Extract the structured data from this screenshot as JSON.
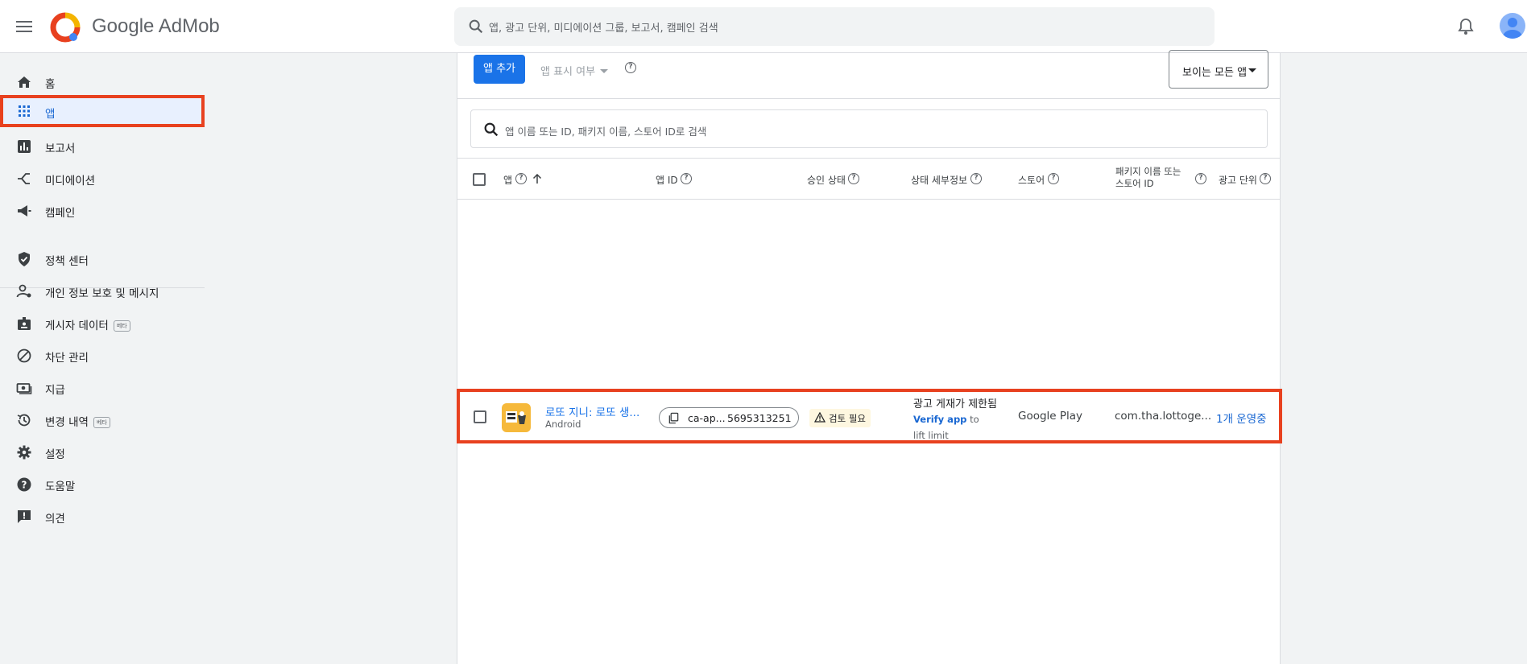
{
  "header": {
    "brand": "Google AdMob",
    "search_placeholder": "앱, 광고 단위, 미디에이션 그룹, 보고서, 캠페인 검색"
  },
  "sidebar": {
    "items": [
      {
        "label": "홈",
        "icon": "home-icon"
      },
      {
        "label": "앱",
        "icon": "apps-grid-icon",
        "active": true
      },
      {
        "label": "보고서",
        "icon": "bar-chart-icon"
      },
      {
        "label": "미디에이션",
        "icon": "mediation-icon"
      },
      {
        "label": "캠페인",
        "icon": "megaphone-icon"
      },
      {
        "label": "정책 센터",
        "icon": "shield-check-icon"
      },
      {
        "label": "개인 정보 보호 및 메시지",
        "icon": "person-settings-icon"
      },
      {
        "label": "게시자 데이터",
        "icon": "badge-icon",
        "badge": "베타"
      },
      {
        "label": "차단 관리",
        "icon": "block-icon"
      },
      {
        "label": "지급",
        "icon": "payments-icon"
      },
      {
        "label": "변경 내역",
        "icon": "history-icon",
        "badge": "베타"
      },
      {
        "label": "설정",
        "icon": "gear-icon"
      },
      {
        "label": "도움말",
        "icon": "help-icon"
      },
      {
        "label": "의견",
        "icon": "feedback-icon"
      }
    ]
  },
  "toolbar": {
    "add_app": "앱 추가",
    "show_toggle": "앱 표시 여부",
    "visible_select": "보이는 모든 앱"
  },
  "app_search_placeholder": "앱 이름 또는 ID, 패키지 이름, 스토어 ID로 검색",
  "table": {
    "columns": [
      "앱",
      "앱 ID",
      "승인 상태",
      "상태 세부정보",
      "스토어",
      "패키지 이름 또는\n스토어 ID",
      "광고 단위"
    ],
    "rows": [
      {
        "app_name": "로또 지니: 로또 생...",
        "platform": "Android",
        "app_id_prefix": "ca-ap...",
        "app_id_suffix": "5695313251",
        "approval": "검토 필요",
        "detail_title": "광고 게재가 제한됨",
        "detail_link": "Verify app",
        "detail_rest": " to lift limit",
        "store": "Google Play",
        "package": "com.tha.lottoge...",
        "ad_units": "1개 운영중"
      }
    ]
  },
  "colors": {
    "accent": "#1a73e8",
    "highlight": "#e8411f",
    "warning_bg": "#fef7e0"
  }
}
